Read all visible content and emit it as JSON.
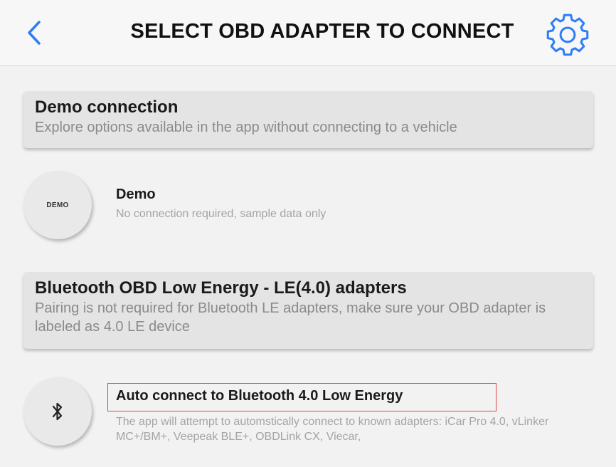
{
  "header": {
    "title": "SELECT OBD ADAPTER TO CONNECT",
    "back_icon": "chevron-left-icon",
    "settings_icon": "gear-icon",
    "accent_color": "#2d7ef7"
  },
  "sections": [
    {
      "title": "Demo connection",
      "description": "Explore options available in the app without connecting to a vehicle",
      "items": [
        {
          "icon_text": "DEMO",
          "title": "Demo",
          "description": "No connection required, sample data only"
        }
      ]
    },
    {
      "title": "Bluetooth OBD Low Energy - LE(4.0) adapters",
      "description": "Pairing is not required for Bluetooth LE adapters, make sure your OBD adapter is labeled as 4.0 LE device",
      "items": [
        {
          "icon": "bluetooth-icon",
          "title": "Auto connect to Bluetooth 4.0 Low Energy",
          "description": "The app will attempt to automstically connect to known adapters: iCar Pro 4.0, vLinker MC+/BM+, Veepeak BLE+, OBDLink CX, Viecar,",
          "highlighted": true,
          "highlight_color": "#e04646"
        }
      ]
    }
  ]
}
